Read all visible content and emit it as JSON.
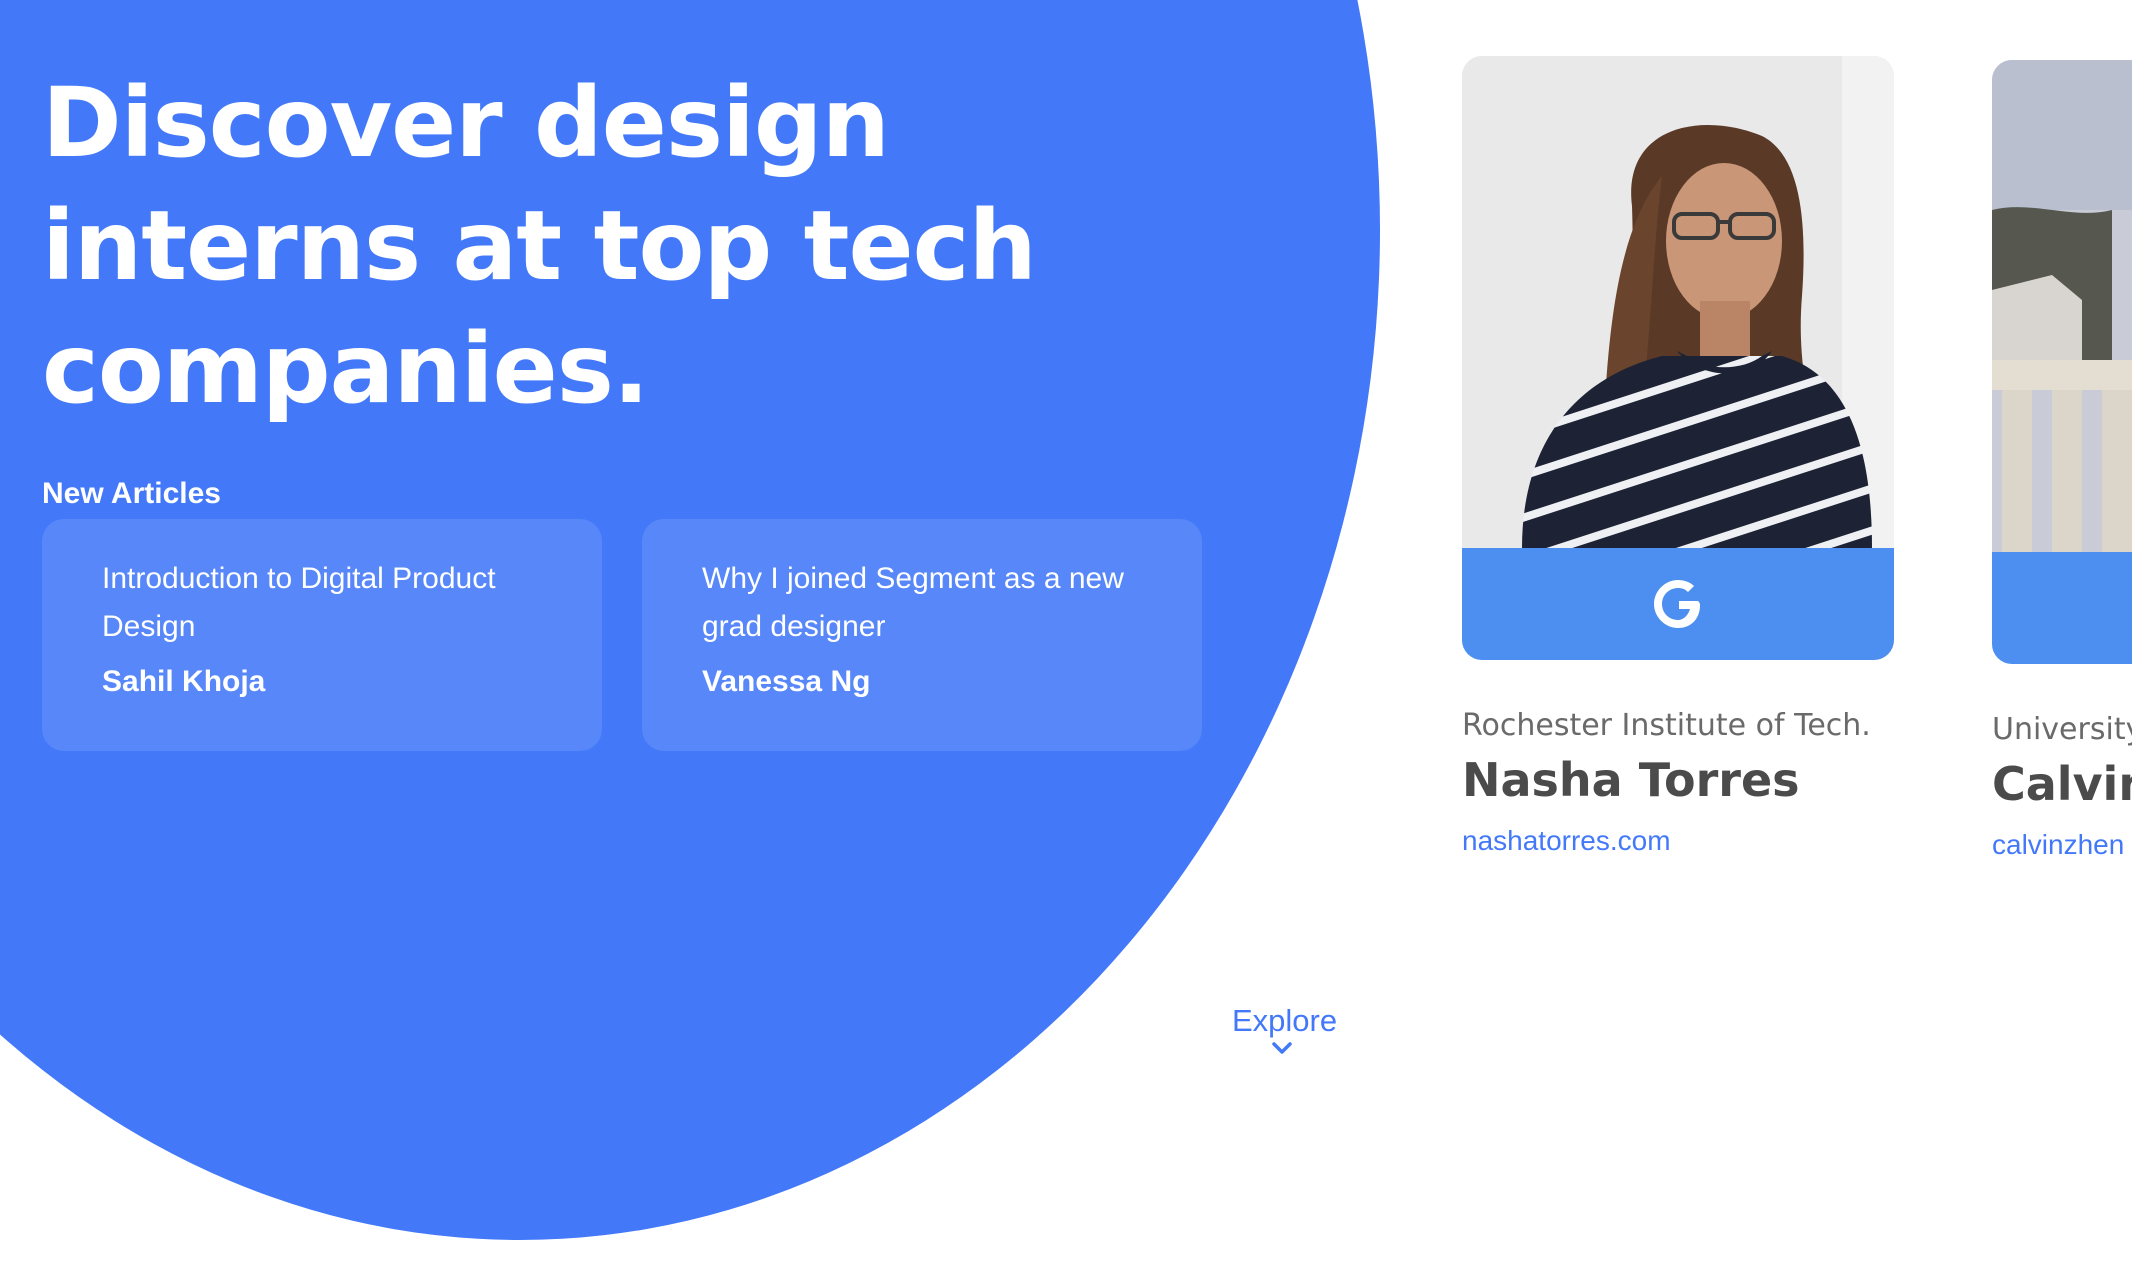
{
  "theme": {
    "accent": "#4379f9",
    "company_bar": "#4c8ff0"
  },
  "hero": {
    "title": "Discover design interns at top tech companies."
  },
  "articles": {
    "label": "New Articles",
    "items": [
      {
        "title": "Introduction to Digital Product Design",
        "author": "Sahil Khoja"
      },
      {
        "title": "Why I joined Segment as a new grad designer",
        "author": "Vanessa Ng"
      }
    ]
  },
  "explore": {
    "label": "Explore",
    "icon": "chevron-down-icon"
  },
  "interns": [
    {
      "school": "Rochester Institute of Tech.",
      "name": "Nasha Torres",
      "site": "nashatorres.com",
      "company_icon": "google-logo-icon"
    },
    {
      "school": "University",
      "name": "Calvin",
      "site": "calvinzhen",
      "company_icon": "company-logo-icon"
    }
  ]
}
